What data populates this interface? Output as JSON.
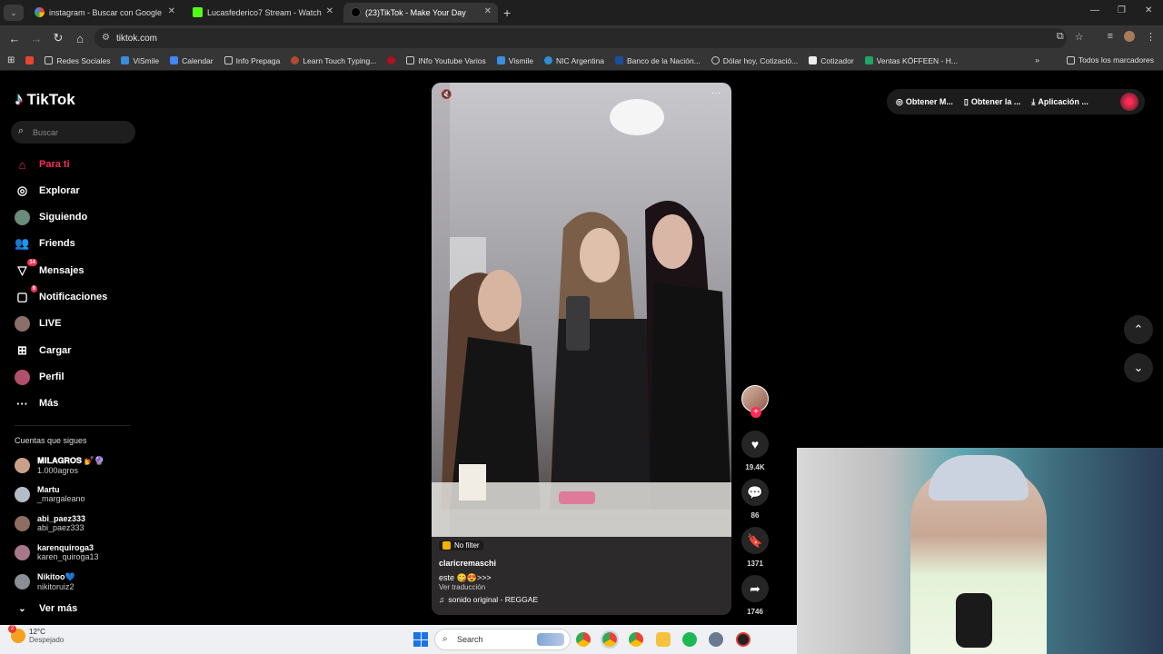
{
  "browser": {
    "tabs": [
      {
        "label": "instagram - Buscar con Google",
        "active": false
      },
      {
        "label": "Lucasfederico7 Stream - Watch",
        "active": false
      },
      {
        "label": "(23)TikTok - Make Your Day",
        "active": true
      }
    ],
    "url": "tiktok.com",
    "bookmarks": [
      "Redes Sociales",
      "ViSmile",
      "Calendar",
      "Info Prepaga",
      "Learn Touch Typing...",
      "INfo Youtube Varios",
      "Vismile",
      "NIC Argentina",
      "Banco de la Nación...",
      "Dólar hoy, Cotizació...",
      "Cotizador",
      "Ventas KÖFFEEN - H..."
    ],
    "bookmarks_all": "Todos los marcadores"
  },
  "sidebar": {
    "logo": "TikTok",
    "search_placeholder": "Buscar",
    "nav": [
      {
        "label": "Para ti",
        "icon": "home-icon",
        "active": true
      },
      {
        "label": "Explorar",
        "icon": "compass-icon"
      },
      {
        "label": "Siguiendo",
        "icon": "following-avatar-icon"
      },
      {
        "label": "Friends",
        "icon": "friends-icon"
      },
      {
        "label": "Mensajes",
        "icon": "messages-icon",
        "badge": "14"
      },
      {
        "label": "Notificaciones",
        "icon": "notifications-icon",
        "badge": "9"
      },
      {
        "label": "LIVE",
        "icon": "live-icon"
      },
      {
        "label": "Cargar",
        "icon": "upload-icon"
      },
      {
        "label": "Perfil",
        "icon": "profile-icon"
      },
      {
        "label": "Más",
        "icon": "more-icon"
      }
    ],
    "following_title": "Cuentas que sigues",
    "following": [
      {
        "name": "𝐌𝐈𝐋𝐀𝐆𝐑𝐎𝐒 💅🔮",
        "handle": "1.000agros"
      },
      {
        "name": "Martu",
        "handle": "_margaleano"
      },
      {
        "name": "abi_paez333",
        "handle": "abi_paez333"
      },
      {
        "name": "karenquiroga3",
        "handle": "karen_quiroga13"
      },
      {
        "name": "Nikitoo💙",
        "handle": "nikitoruiz2"
      }
    ],
    "see_more": "Ver más"
  },
  "video": {
    "filter": "No filter",
    "username": "claricremaschi",
    "description": "este 😋😍>>>",
    "translate": "Ver traducción",
    "sound": "sonido original - REGGAE",
    "likes": "19.4K",
    "comments": "86",
    "saves": "1371",
    "shares": "1746"
  },
  "top_actions": {
    "coins": "Obtener M...",
    "app": "Obtener la ...",
    "download": "Aplicación ..."
  },
  "taskbar": {
    "temperature": "12°C",
    "condition": "Despejado",
    "search": "Search",
    "weather_badge": "2"
  }
}
